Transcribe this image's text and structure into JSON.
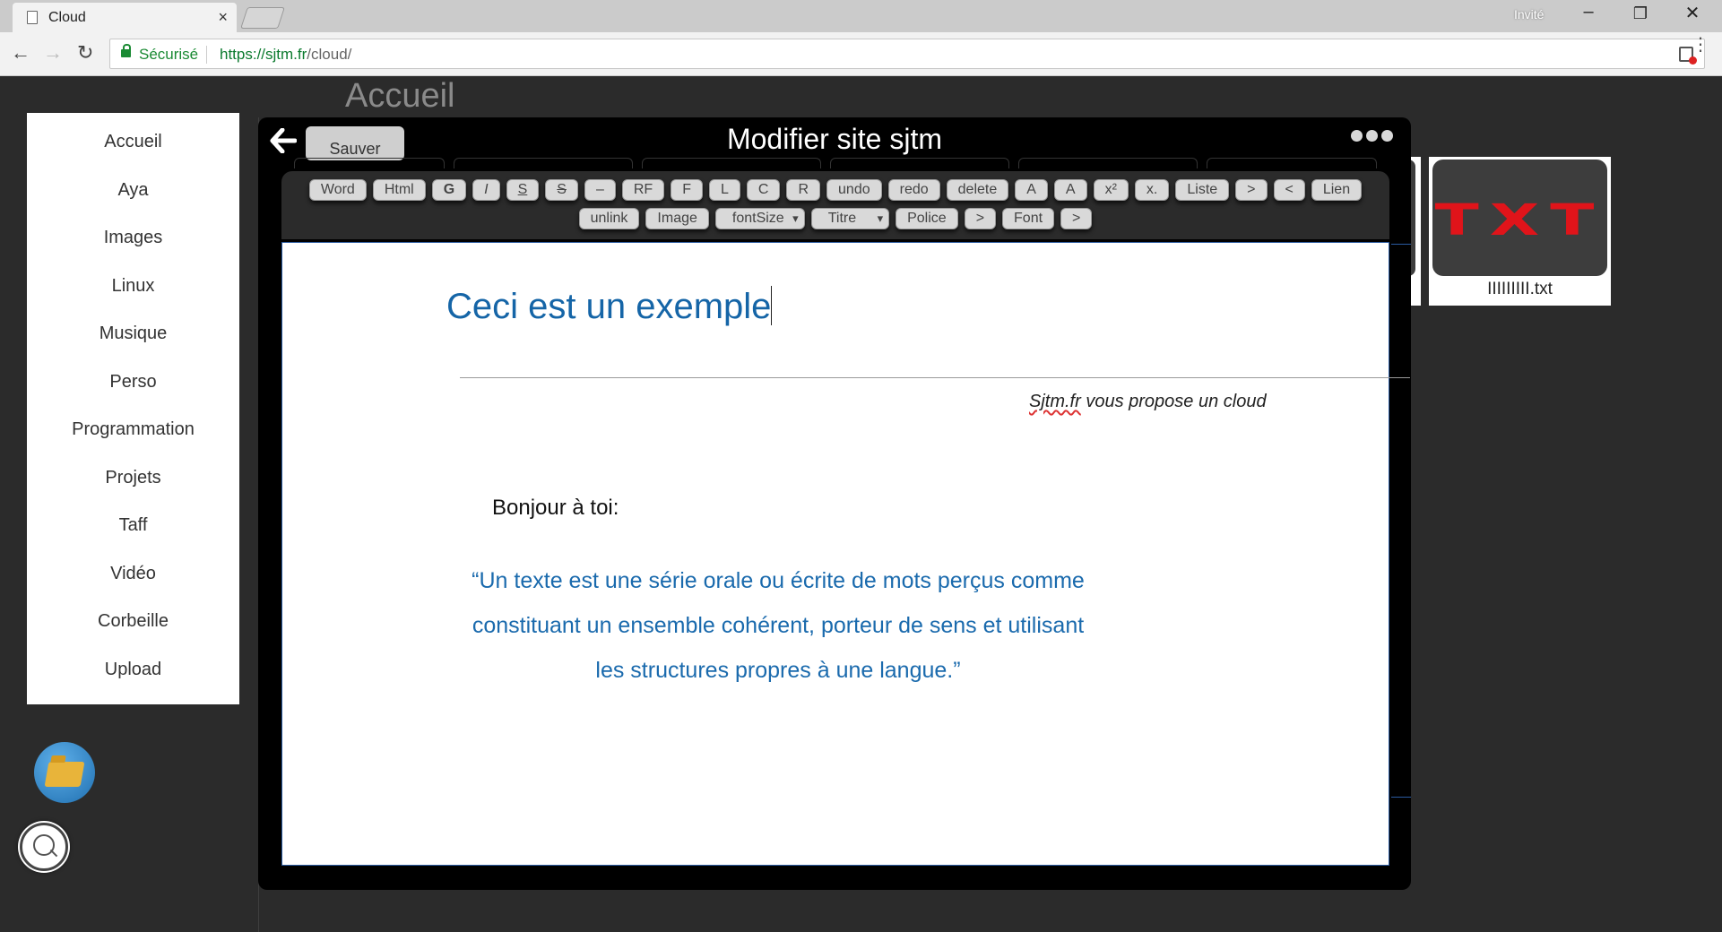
{
  "browser": {
    "tab_title": "Cloud",
    "tab_close": "×",
    "guest_label": "Invité",
    "security_label": "Sécurisé",
    "url_host": "https://sjtm.fr",
    "url_path": "/cloud/"
  },
  "page": {
    "title": "Accueil"
  },
  "sidebar": {
    "items": [
      {
        "label": "Accueil"
      },
      {
        "label": "Aya"
      },
      {
        "label": "Images"
      },
      {
        "label": "Linux"
      },
      {
        "label": "Musique"
      },
      {
        "label": "Perso"
      },
      {
        "label": "Programmation"
      },
      {
        "label": "Projets"
      },
      {
        "label": "Taff"
      },
      {
        "label": "Vidéo"
      },
      {
        "label": "Corbeille"
      },
      {
        "label": "Upload"
      }
    ]
  },
  "file_card": {
    "thumb_text": "TXT",
    "name": "IIIIIIIII.txt"
  },
  "modal": {
    "title": "Modifier site sjtm",
    "save_label": "Sauver"
  },
  "toolbar": {
    "row1": [
      "Word",
      "Html",
      "G",
      "I",
      "S",
      "S",
      "–",
      "RF",
      "F",
      "L",
      "C",
      "R",
      "undo",
      "redo",
      "delete",
      "A",
      "A",
      "x²",
      "x.",
      "Liste",
      ">",
      "<",
      "Lien"
    ],
    "row2_unlink": "unlink",
    "row2_image": "Image",
    "row2_fontsize": "fontSize",
    "row2_titre": "Titre",
    "row2_police": "Police",
    "row2_gt1": ">",
    "row2_font": "Font",
    "row2_gt2": ">"
  },
  "editor": {
    "heading": "Ceci est un exemple",
    "sub_brand": "Sjtm.fr",
    "sub_rest": " vous propose un cloud",
    "greeting": "Bonjour à toi:",
    "quote_line1": "“Un texte est une série orale ou écrite de mots perçus comme",
    "quote_line2": "constituant un ensemble cohérent, porteur de sens et utilisant",
    "quote_line3": "les structures propres à une langue.”"
  },
  "colors": {
    "accent_blue": "#1565a7",
    "secure_green": "#1a8a33",
    "txt_red": "#e0141a"
  }
}
